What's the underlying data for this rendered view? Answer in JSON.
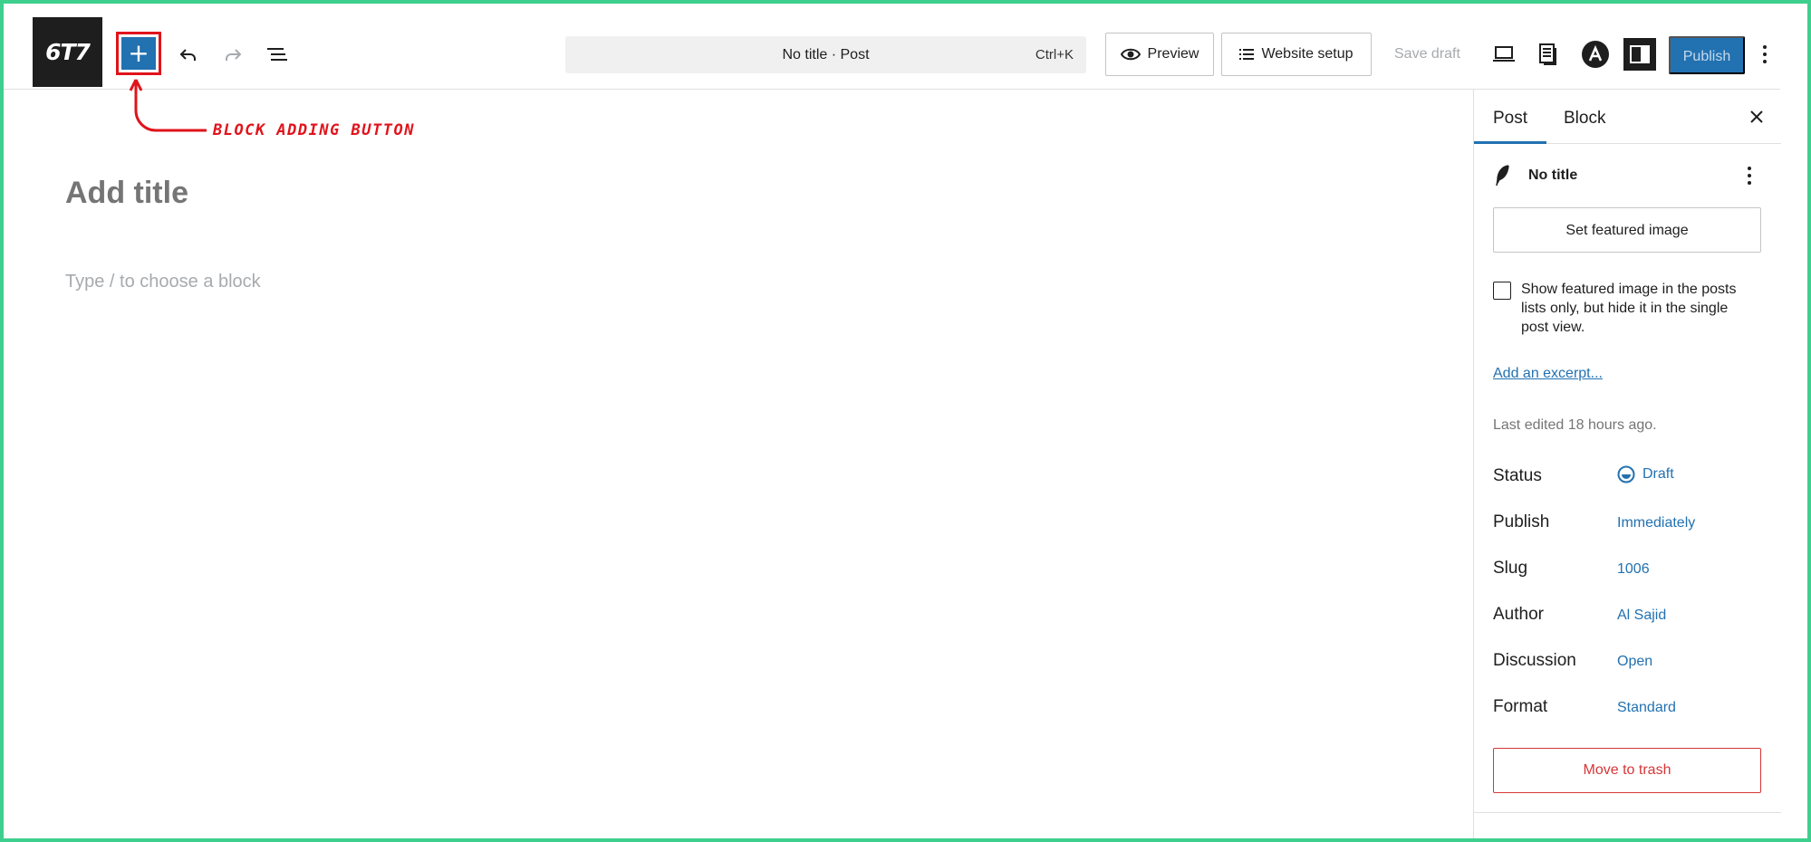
{
  "header": {
    "logo_text": "6T7",
    "add_block_label": "+",
    "command_bar": {
      "title": "No title · Post",
      "shortcut": "Ctrl+K"
    },
    "preview_label": "Preview",
    "website_setup_label": "Website setup",
    "save_draft_label": "Save draft",
    "publish_label": "Publish",
    "icons": [
      "undo-icon",
      "redo-icon",
      "document-overview-icon",
      "desktop-view-icon",
      "document-icon",
      "astra-icon",
      "sidebar-toggle-icon",
      "more-options-icon"
    ]
  },
  "annotation": {
    "label": "BLOCK ADDING BUTTON",
    "color": "#e0131b"
  },
  "editor": {
    "title_placeholder": "Add title",
    "block_placeholder": "Type / to choose a block"
  },
  "sidebar": {
    "tabs": [
      {
        "label": "Post",
        "active": true
      },
      {
        "label": "Block",
        "active": false
      }
    ],
    "post_name": "No title",
    "featured_image_label": "Set featured image",
    "featured_checkbox_label": "Show featured image in the posts lists only, but hide it in the single post view.",
    "excerpt_label": "Add an excerpt...",
    "last_edited": "Last edited 18 hours ago.",
    "meta": [
      {
        "label": "Status",
        "value": "Draft"
      },
      {
        "label": "Publish",
        "value": "Immediately"
      },
      {
        "label": "Slug",
        "value": "1006"
      },
      {
        "label": "Author",
        "value": "Al Sajid"
      },
      {
        "label": "Discussion",
        "value": "Open"
      },
      {
        "label": "Format",
        "value": "Standard"
      }
    ],
    "trash_label": "Move to trash"
  },
  "colors": {
    "accent": "#2271b1",
    "danger": "#d63638",
    "frame": "#3ecf8e"
  }
}
